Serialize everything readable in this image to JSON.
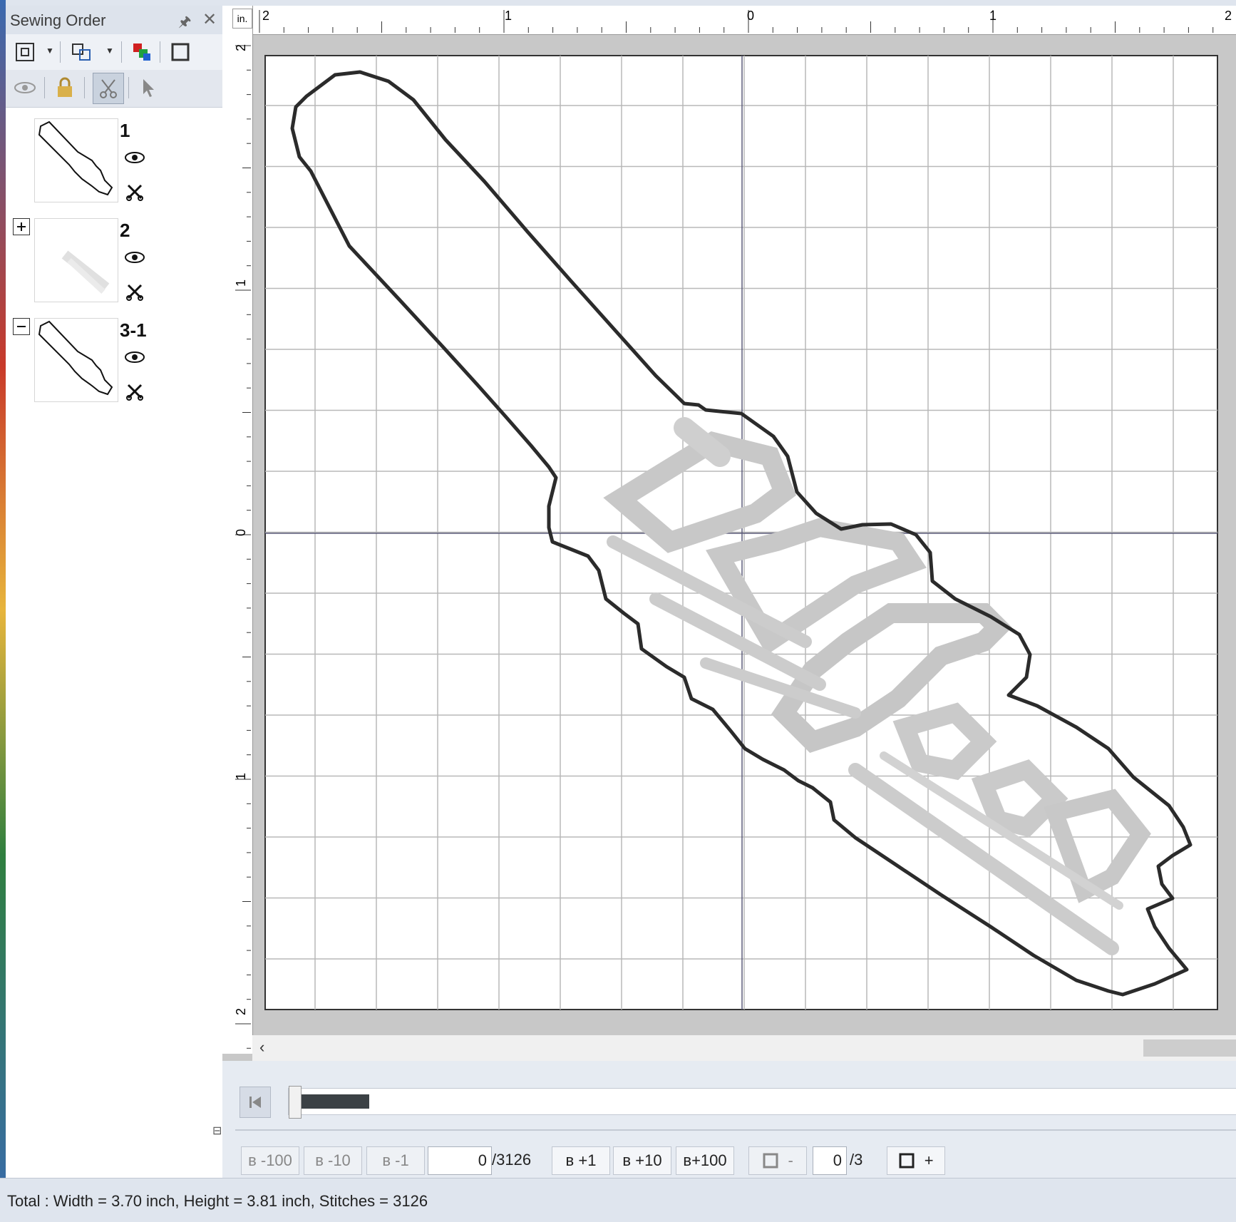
{
  "panel": {
    "title": "Sewing Order",
    "items": [
      {
        "label": "1"
      },
      {
        "label": "2"
      },
      {
        "label": "3-1"
      }
    ]
  },
  "ruler": {
    "unit": "in.",
    "top_labels": [
      "2",
      "1",
      "0",
      "1",
      "2"
    ],
    "left_labels": [
      "2",
      "1",
      "0",
      "1",
      "2"
    ]
  },
  "stitch_nav": {
    "minus100": "-100",
    "minus10": "-10",
    "minus1": "-1",
    "current_stitch": "0",
    "total_stitches": "/3126",
    "plus1": "+1",
    "plus10": "+10",
    "plus100": "+100",
    "color_minus": "-",
    "current_color": "0",
    "total_colors": "/3",
    "color_plus": "+"
  },
  "progress": {
    "value": 0.05
  },
  "status": {
    "text": "Total : Width = 3.70 inch, Height = 3.81 inch, Stitches = 3126"
  }
}
